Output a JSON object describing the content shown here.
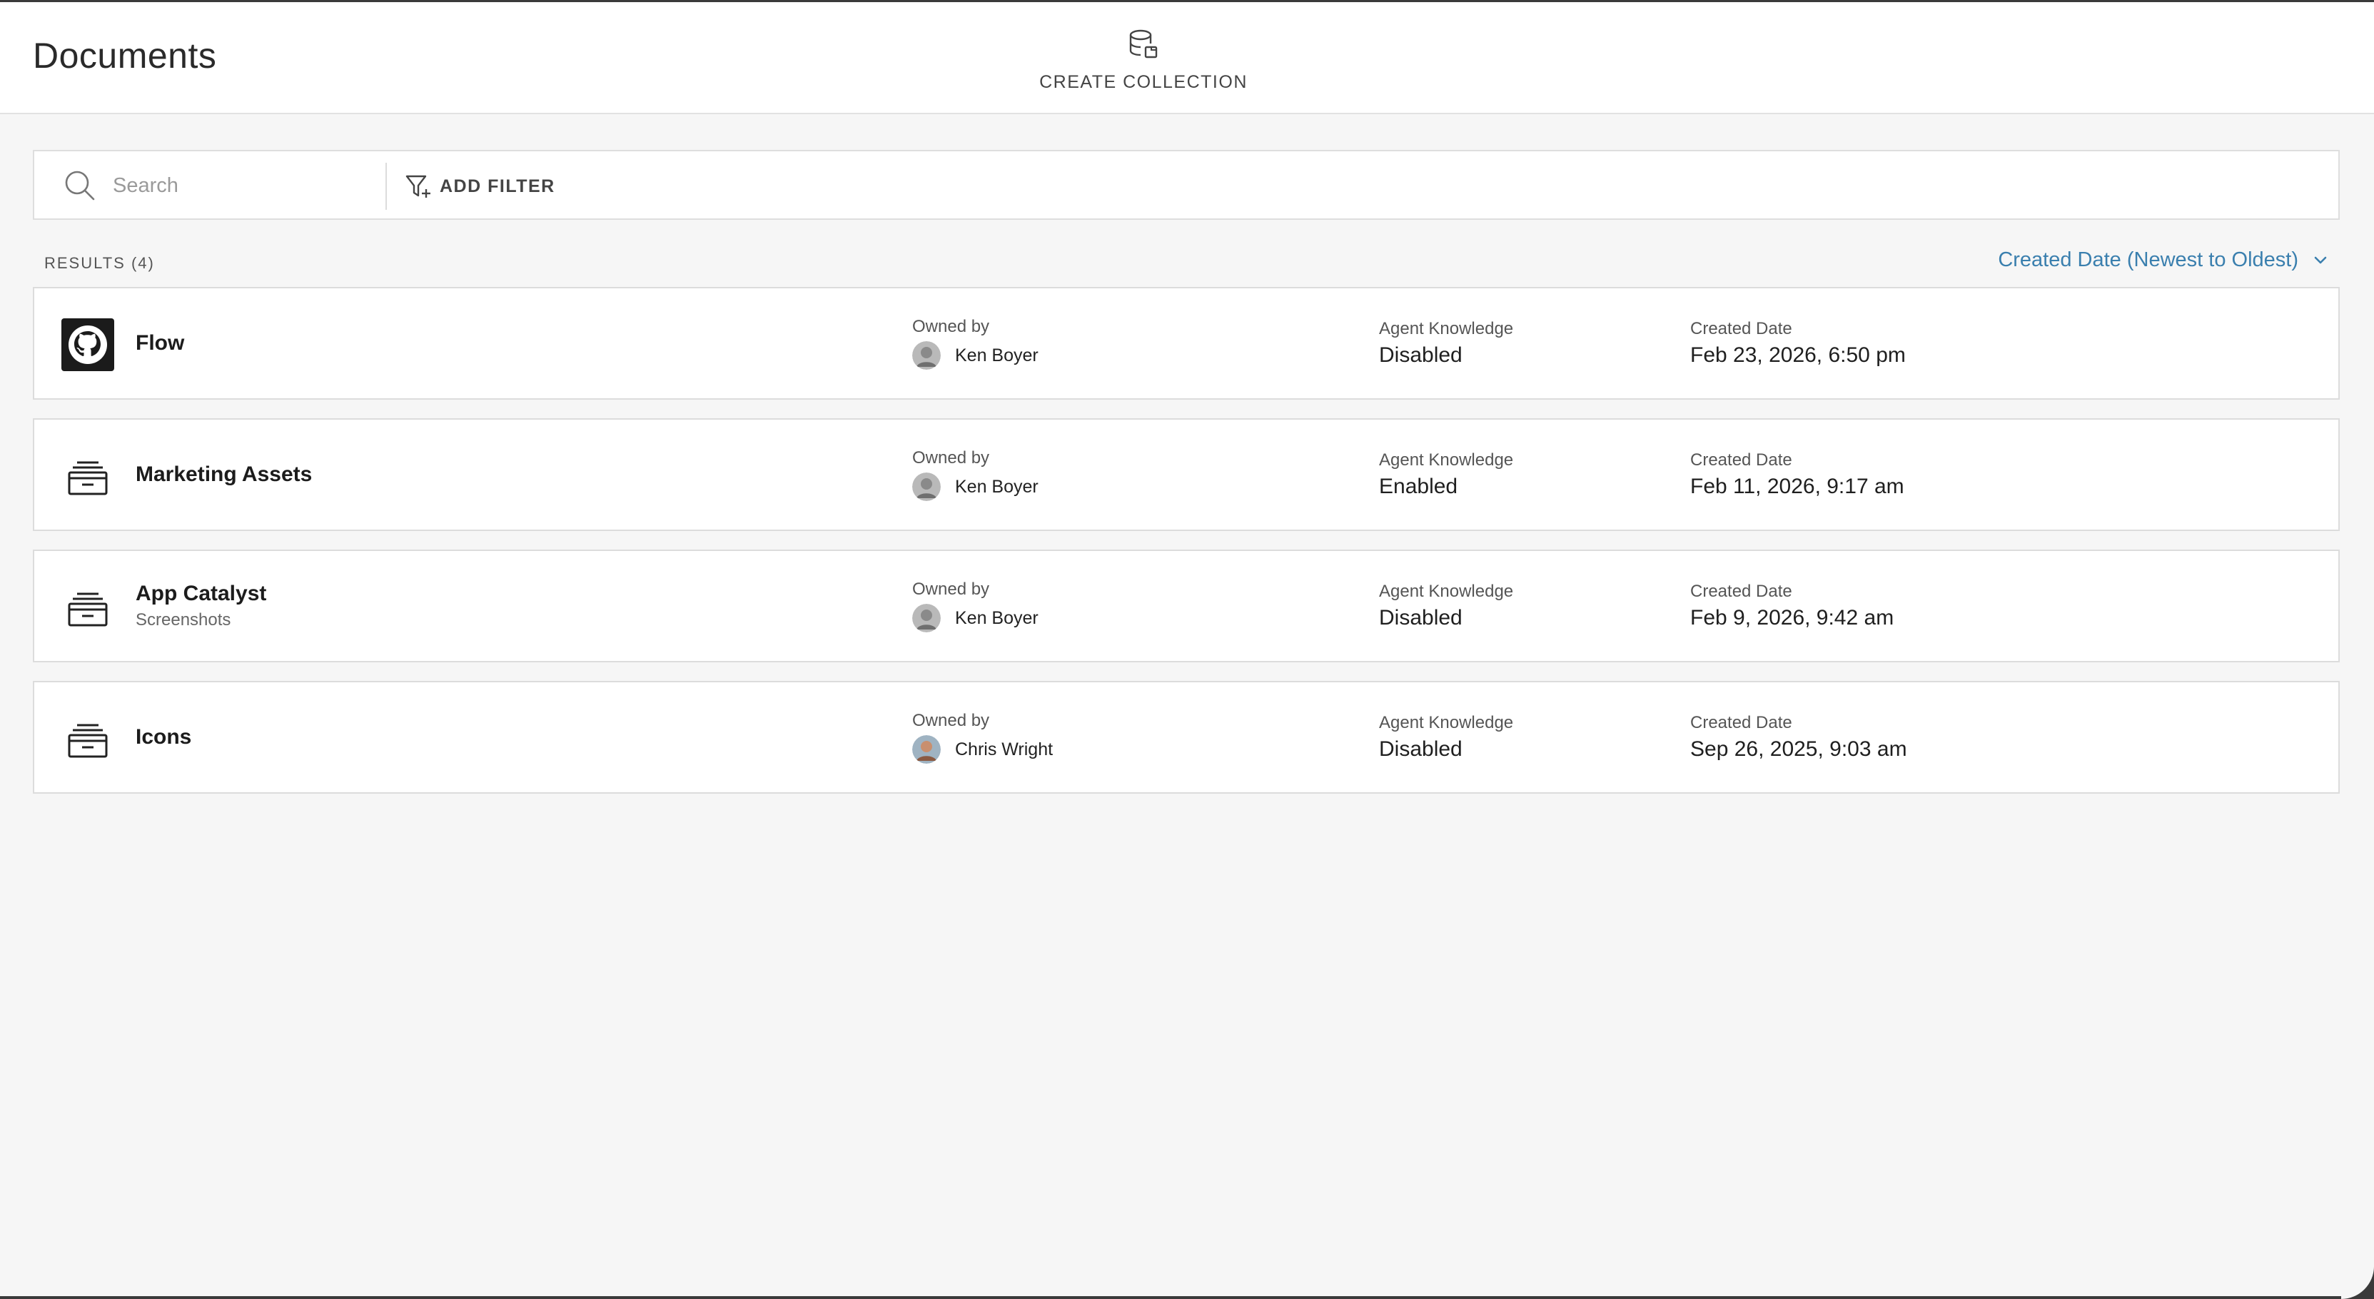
{
  "header": {
    "title": "Documents",
    "create_collection_label": "CREATE COLLECTION"
  },
  "search": {
    "placeholder": "Search",
    "value": "",
    "add_filter_label": "ADD FILTER"
  },
  "results": {
    "count_label": "RESULTS (4)",
    "sort_label": "Created Date (Newest to Oldest)"
  },
  "columns": {
    "owner_label": "Owned by",
    "knowledge_label": "Agent Knowledge",
    "date_label": "Created Date"
  },
  "items": [
    {
      "name": "Flow",
      "subtitle": "",
      "icon": "github-icon",
      "owner": "Ken Boyer",
      "owner_avatar": "avatar-gray",
      "agent_knowledge": "Disabled",
      "created_date": "Feb 23, 2026, 6:50 pm"
    },
    {
      "name": "Marketing Assets",
      "subtitle": "",
      "icon": "archive-box-icon",
      "owner": "Ken Boyer",
      "owner_avatar": "avatar-gray",
      "agent_knowledge": "Enabled",
      "created_date": "Feb 11, 2026, 9:17 am"
    },
    {
      "name": "App Catalyst",
      "subtitle": "Screenshots",
      "icon": "archive-box-icon",
      "owner": "Ken Boyer",
      "owner_avatar": "avatar-gray",
      "agent_knowledge": "Disabled",
      "created_date": "Feb 9, 2026, 9:42 am"
    },
    {
      "name": "Icons",
      "subtitle": "",
      "icon": "archive-box-icon",
      "owner": "Chris Wright",
      "owner_avatar": "avatar-color",
      "agent_knowledge": "Disabled",
      "created_date": "Sep 26, 2025, 9:03 am"
    }
  ],
  "colors": {
    "accent": "#3a7fae",
    "background": "#f6f6f6",
    "card": "#ffffff",
    "border": "#dcdcdc"
  }
}
